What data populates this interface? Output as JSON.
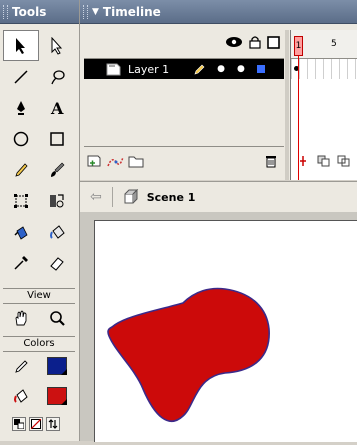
{
  "tools_panel": {
    "title": "Tools",
    "view_label": "View",
    "colors_label": "Colors"
  },
  "timeline": {
    "title": "Timeline",
    "frame_number": "1",
    "ruler_mark": "5",
    "layers": [
      {
        "name": "Layer 1"
      }
    ]
  },
  "scene": {
    "label": "Scene 1"
  },
  "colors": {
    "stroke": "#0b1f8c",
    "fill": "#cc1111",
    "shape_fill": "#cc0a0a",
    "shape_stroke": "#3b2a8a",
    "layer_color_box": "#3b6fff"
  }
}
